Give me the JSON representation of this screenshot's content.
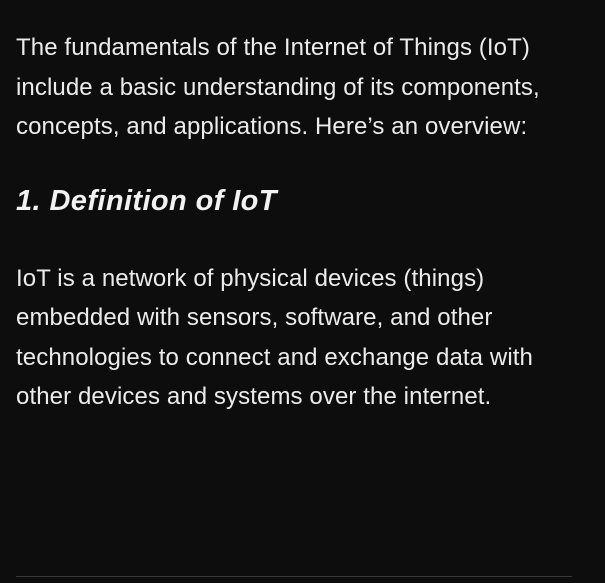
{
  "article": {
    "intro": "The fundamentals of the Internet of Things (IoT) include a basic understanding of its components, concepts, and applications. Here’s an overview:",
    "section_1": {
      "heading": "1. Definition of IoT",
      "body": "IoT is a network of physical devices (things) embedded with sensors, software, and other technologies to connect and exchange data with other devices and systems over the internet."
    }
  },
  "colors": {
    "background": "#0d0d0d",
    "text": "#ececec",
    "divider": "#3a3a3a"
  }
}
